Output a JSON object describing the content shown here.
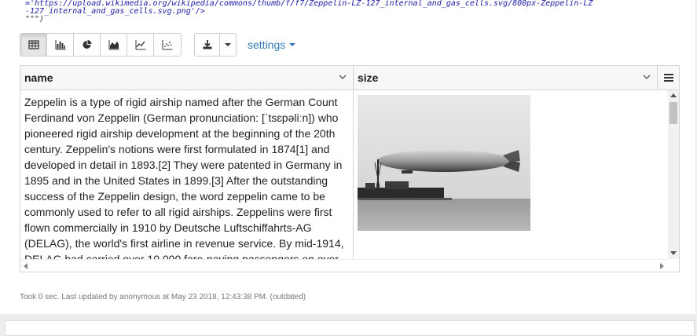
{
  "code": {
    "line1": "='https://upload.wikimedia.org/wikipedia/commons/thumb/f/f7/Zeppelin-LZ-127_internal_and_gas_cells.svg/800px-Zeppelin-LZ",
    "line2": "-127_internal_and_gas_cells.svg.png'/>",
    "line3": "\"\"\")"
  },
  "toolbar": {
    "view_buttons": [
      {
        "name": "table-view",
        "icon": "table-icon"
      },
      {
        "name": "bar-chart-view",
        "icon": "bar-chart-icon"
      },
      {
        "name": "pie-chart-view",
        "icon": "pie-chart-icon"
      },
      {
        "name": "area-chart-view",
        "icon": "area-chart-icon"
      },
      {
        "name": "line-chart-view",
        "icon": "line-chart-icon"
      },
      {
        "name": "scatter-chart-view",
        "icon": "scatter-chart-icon"
      }
    ],
    "active_view": "table-view",
    "settings_label": "settings"
  },
  "table": {
    "columns": [
      "name",
      "size"
    ],
    "rows": [
      {
        "name": "Zeppelin is a type of rigid airship named after the German Count Ferdinand von Zeppelin (German pronunciation: [ˈtsɛpəliːn]) who pioneered rigid airship development at the beginning of the 20th century. Zeppelin's notions were first formulated in 1874[1] and developed in detail in 1893.[2] They were patented in Germany in 1895 and in the United States in 1899.[3] After the outstanding success of the Zeppelin design, the word zeppelin came to be commonly used to refer to all rigid airships. Zeppelins were first flown commercially in 1910 by Deutsche Luftschiffahrts-AG (DELAG), the world's first airline in revenue service. By mid-1914, DELAG had carried over 10,000 fare-paying passengers on over",
        "size_image": "zeppelin-photo"
      }
    ]
  },
  "status": "Took 0 sec. Last updated by anonymous at May 23 2018, 12:43:38 PM. (outdated)"
}
